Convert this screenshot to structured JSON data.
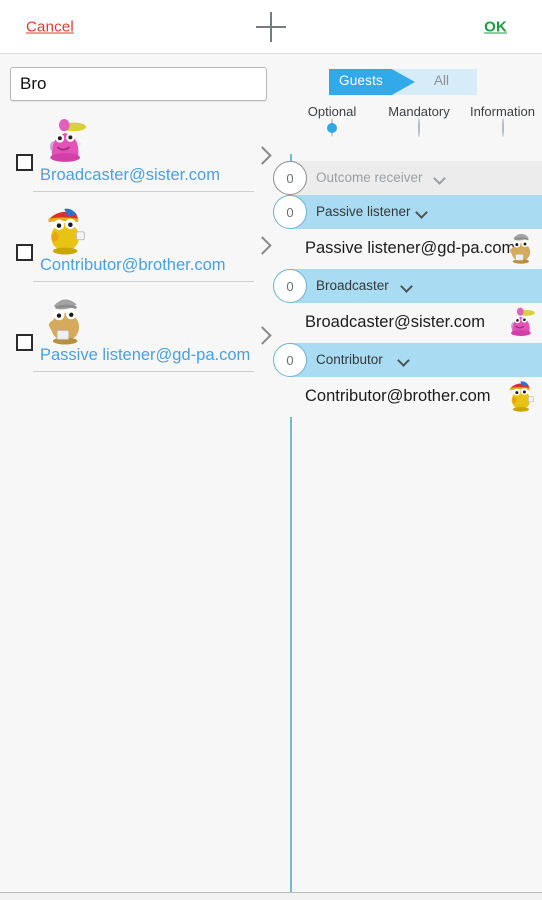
{
  "topbar": {
    "cancel_label": "Cancel",
    "ok_label": "OK",
    "add_icon": "plus-icon"
  },
  "search": {
    "value": "Bro",
    "placeholder": ""
  },
  "contacts": [
    {
      "email": "Broadcaster@sister.com",
      "checked": false,
      "avatar": "pink-character-avatar"
    },
    {
      "email": "Contributor@brother.com",
      "checked": false,
      "avatar": "yellow-bird-avatar"
    },
    {
      "email": "Passive listener@gd-pa.com",
      "checked": false,
      "avatar": "gray-bird-avatar"
    }
  ],
  "segmented": {
    "guests_label": "Guests",
    "all_label": "All",
    "selected": "Guests",
    "active_color": "#32aaea",
    "inactive_color": "#d6ecf8"
  },
  "radios": [
    {
      "label": "Optional",
      "selected": true
    },
    {
      "label": "Mandatory",
      "selected": false
    },
    {
      "label": "Information",
      "selected": false
    }
  ],
  "groups": [
    {
      "badge": "0",
      "label": "Outcome receiver",
      "state": "inactive",
      "items": []
    },
    {
      "badge": "0",
      "label": "Passive listener",
      "state": "active",
      "items": [
        {
          "email": "Passive listener@gd-pa.com",
          "avatar": "gray-bird-avatar"
        }
      ]
    },
    {
      "badge": "0",
      "label": "Broadcaster",
      "state": "active",
      "items": [
        {
          "email": "Broadcaster@sister.com",
          "avatar": "pink-character-avatar"
        }
      ]
    },
    {
      "badge": "0",
      "label": "Contributor",
      "state": "active",
      "items": [
        {
          "email": "Contributor@brother.com",
          "avatar": "yellow-bird-avatar"
        }
      ]
    }
  ],
  "fab": {
    "icon": "plus-icon",
    "color": "#2196f3"
  }
}
